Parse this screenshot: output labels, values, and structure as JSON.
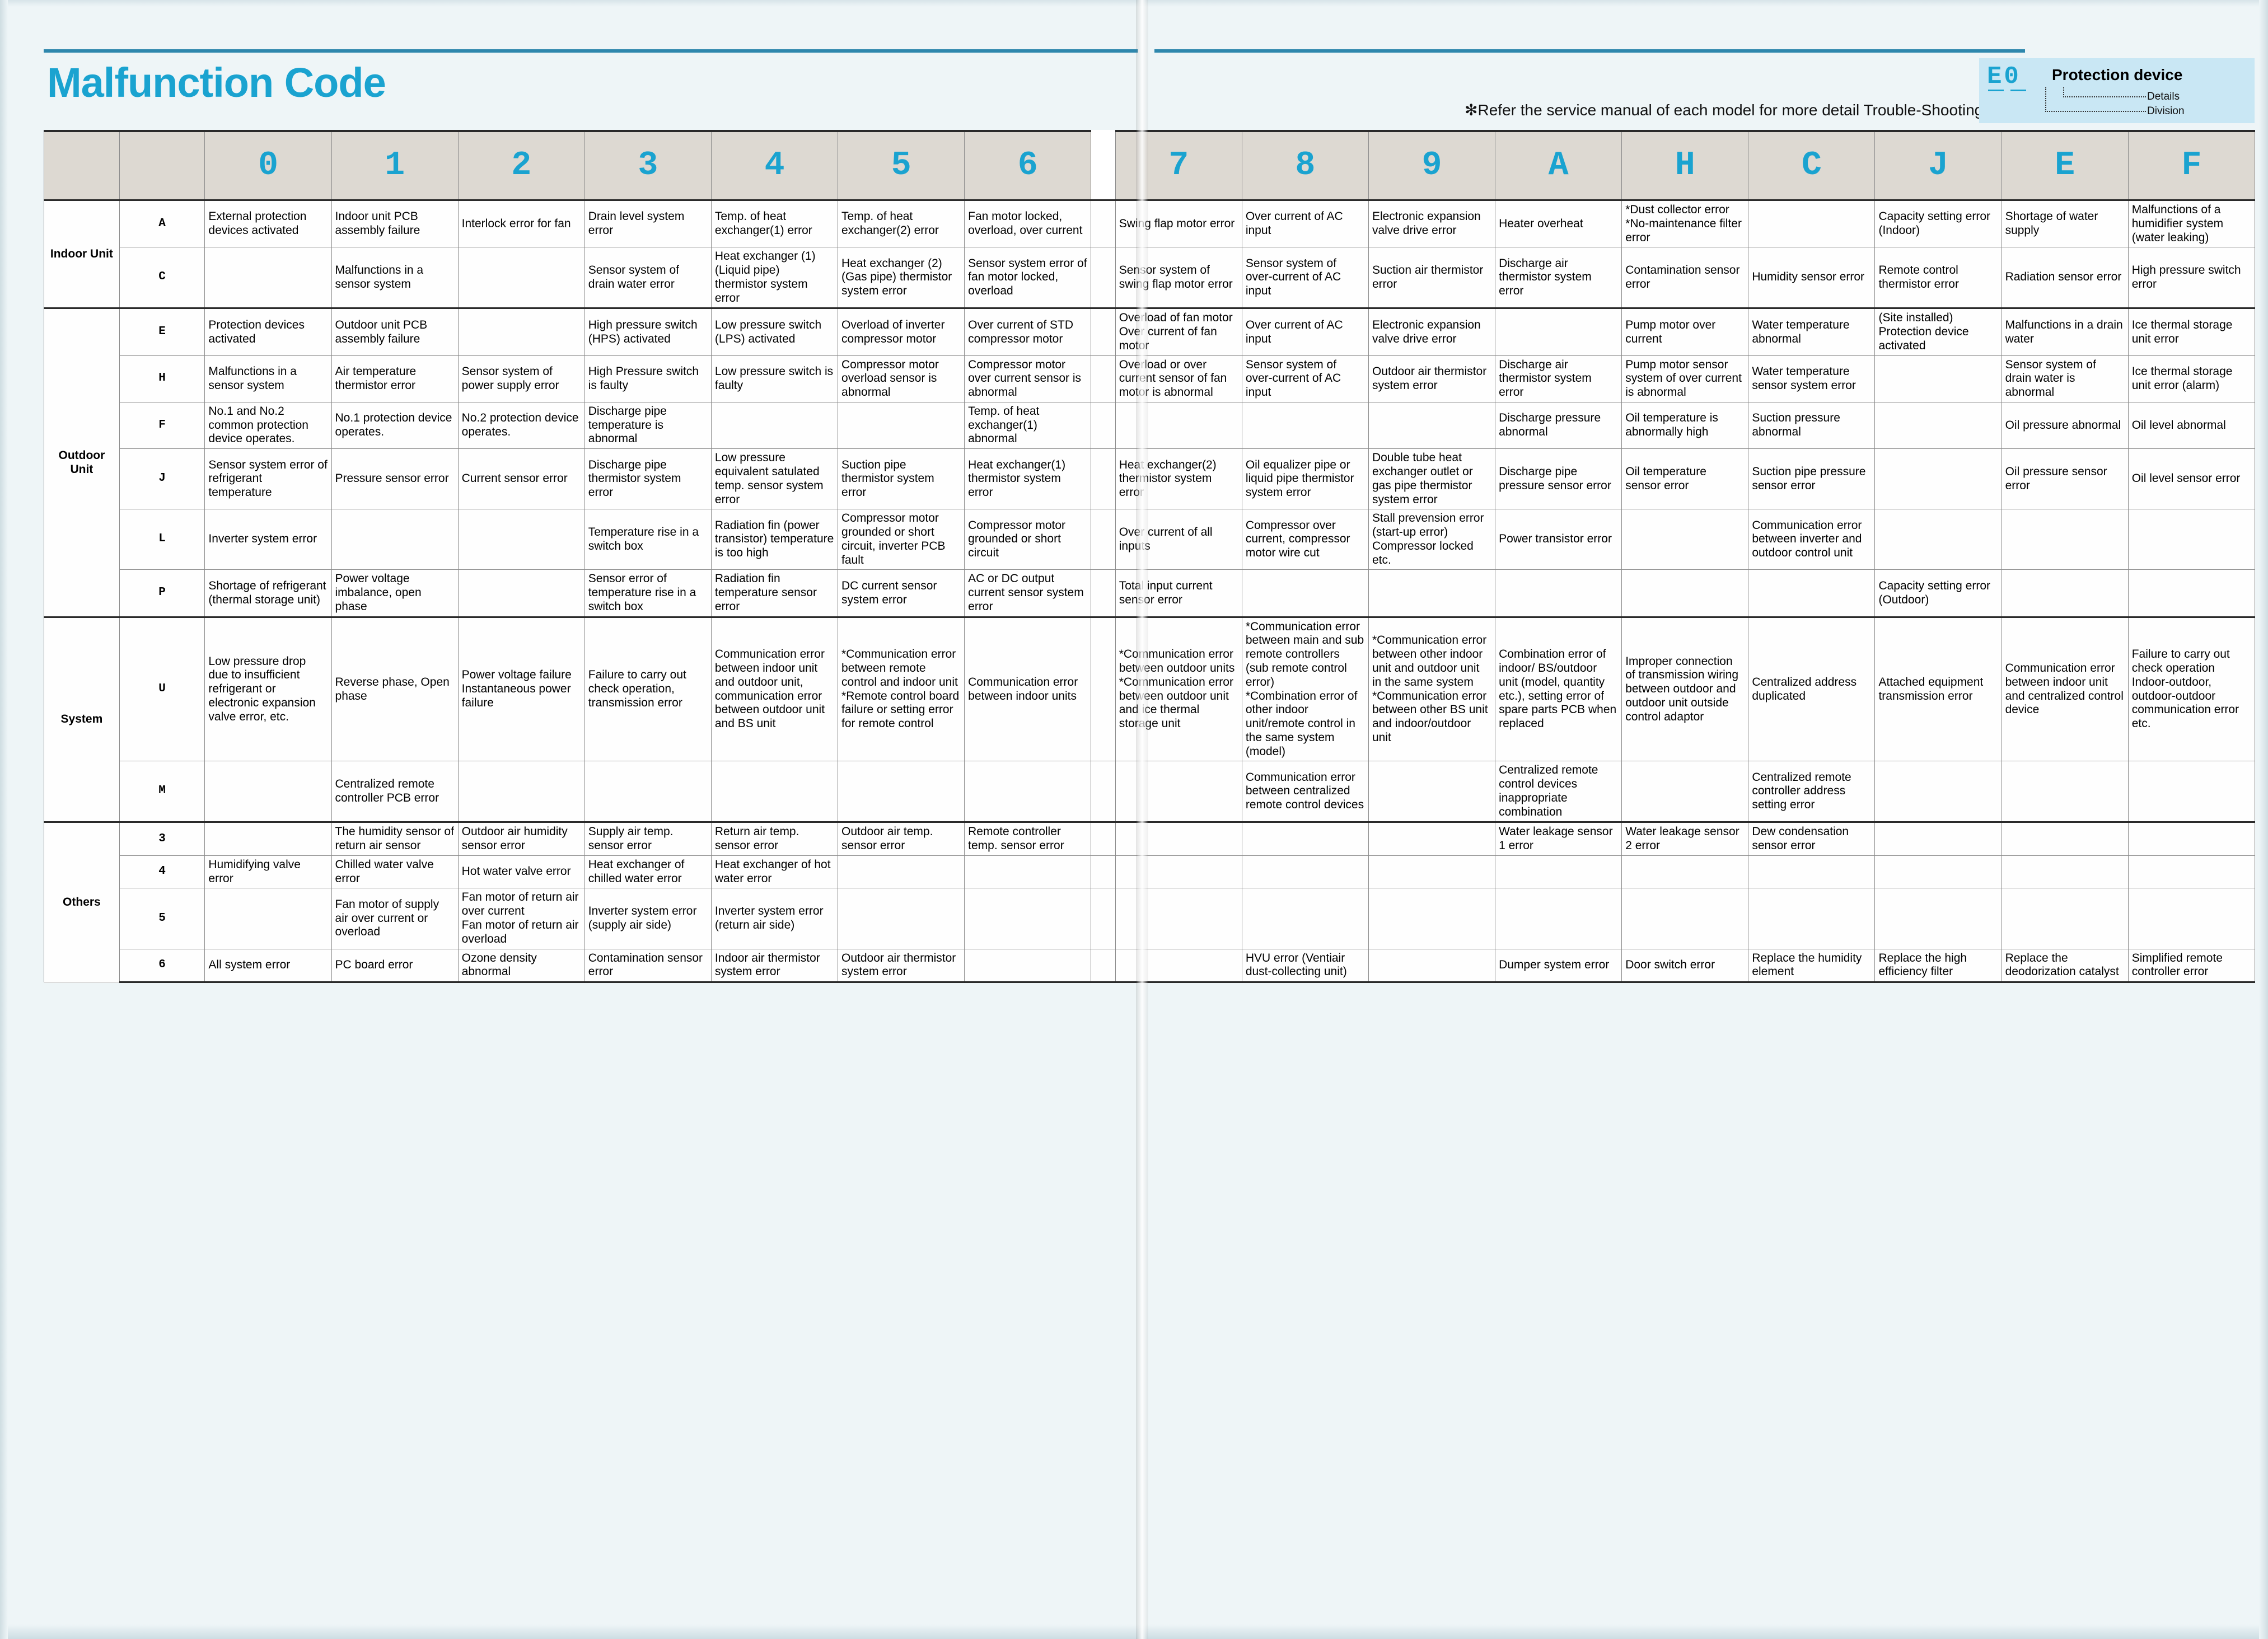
{
  "title": "Malfunction Code",
  "note": "✻Refer the service manual of each model for more detail Trouble-Shooting.",
  "legend": {
    "code": "E0",
    "title": "Protection device",
    "details_label": "Details",
    "division_label": "Division"
  },
  "colors": {
    "accent": "#1aa3d0",
    "rule": "#2e87ad",
    "section_bg": "#aee0f2",
    "code_bg": "#ddd9d2",
    "legend_bg": "#c9e7f4"
  },
  "columns": [
    "0",
    "1",
    "2",
    "3",
    "4",
    "5",
    "6",
    "7",
    "8",
    "9",
    "A",
    "H",
    "C",
    "J",
    "E",
    "F"
  ],
  "sections": [
    {
      "label": "Indoor Unit",
      "rows": [
        {
          "code": "A",
          "cells": [
            "External protection devices activated",
            "Indoor unit PCB assembly failure",
            "Interlock error for fan",
            "Drain level system error",
            "Temp. of heat exchanger(1) error",
            "Temp. of heat exchanger(2) error",
            "Fan motor locked, overload, over current",
            "Swing flap motor error",
            "Over current of AC input",
            "Electronic expansion valve drive error",
            "Heater overheat",
            "*Dust collector error\n*No-maintenance filter error",
            "",
            "Capacity setting error (Indoor)",
            "Shortage of water supply",
            "Malfunctions of a humidifier system (water leaking)"
          ]
        },
        {
          "code": "C",
          "cells": [
            "",
            "Malfunctions in a sensor system",
            "",
            "Sensor system of drain water error",
            "Heat exchanger (1) (Liquid pipe) thermistor system error",
            "Heat exchanger (2) (Gas pipe) thermistor system error",
            "Sensor system error of fan motor locked, overload",
            "Sensor system of swing flap motor error",
            "Sensor system of over-current of AC input",
            "Suction air thermistor error",
            "Discharge air thermistor system error",
            "Contamination sensor error",
            "Humidity sensor error",
            "Remote control thermistor error",
            "Radiation sensor error",
            "High pressure switch error"
          ]
        }
      ]
    },
    {
      "label": "Outdoor Unit",
      "rows": [
        {
          "code": "E",
          "cells": [
            "Protection devices activated",
            "Outdoor unit PCB assembly failure",
            "",
            "High pressure switch (HPS) activated",
            "Low pressure switch (LPS) activated",
            "Overload of inverter compressor motor",
            "Over current of STD compressor motor",
            "Overload of fan motor\nOver current of fan motor",
            "Over current of AC input",
            "Electronic expansion valve drive error",
            "",
            "Pump motor over current",
            "Water temperature abnormal",
            "(Site installed) Protection device activated",
            "Malfunctions in a drain water",
            "Ice thermal storage unit error"
          ]
        },
        {
          "code": "H",
          "cells": [
            "Malfunctions in a sensor system",
            "Air temperature thermistor error",
            "Sensor system of power supply error",
            "High Pressure switch is faulty",
            "Low pressure switch is faulty",
            "Compressor motor overload sensor is abnormal",
            "Compressor motor over current sensor is abnormal",
            "Overload or over current sensor of fan motor is abnormal",
            "Sensor system of over-current of AC input",
            "Outdoor air thermistor system error",
            "Discharge air thermistor system error",
            "Pump motor sensor system of over current is abnormal",
            "Water temperature sensor system error",
            "",
            "Sensor system of drain water is abnormal",
            "Ice thermal storage unit error (alarm)"
          ]
        },
        {
          "code": "F",
          "cells": [
            "No.1 and No.2 common protection device operates.",
            "No.1 protection device operates.",
            "No.2 protection device operates.",
            "Discharge pipe temperature is abnormal",
            "",
            "",
            "Temp. of heat exchanger(1) abnormal",
            "",
            "",
            "",
            "Discharge pressure abnormal",
            "Oil temperature is abnormally high",
            "Suction pressure abnormal",
            "",
            "Oil pressure abnormal",
            "Oil level abnormal"
          ]
        },
        {
          "code": "J",
          "cells": [
            "Sensor system error of refrigerant temperature",
            "Pressure sensor error",
            "Current sensor error",
            "Discharge pipe thermistor system error",
            "Low pressure equivalent satulated temp. sensor system error",
            "Suction pipe thermistor system error",
            "Heat exchanger(1) thermistor system error",
            "Heat exchanger(2) thermistor system error",
            "Oil equalizer pipe or liquid pipe thermistor system error",
            "Double tube heat exchanger outlet or gas pipe thermistor system error",
            "Discharge pipe pressure sensor error",
            "Oil temperature sensor error",
            "Suction pipe pressure sensor error",
            "",
            "Oil pressure sensor error",
            "Oil level sensor error"
          ]
        },
        {
          "code": "L",
          "cells": [
            "Inverter system error",
            "",
            "",
            "Temperature rise in a switch box",
            "Radiation fin (power transistor) temperature is too high",
            "Compressor motor grounded or short circuit, inverter PCB fault",
            "Compressor motor grounded or short circuit",
            "Over current of all inputs",
            "Compressor over current, compressor motor wire cut",
            "Stall prevension error (start-up error) Compressor locked etc.",
            "Power transistor error",
            "",
            "Communication error between inverter and outdoor control unit",
            "",
            "",
            ""
          ]
        },
        {
          "code": "P",
          "cells": [
            "Shortage of refrigerant (thermal storage unit)",
            "Power voltage imbalance, open phase",
            "",
            "Sensor error of temperature rise in a switch box",
            "Radiation fin temperature sensor error",
            "DC current sensor system error",
            "AC or DC output current sensor system error",
            "Total input current sensor error",
            "",
            "",
            "",
            "",
            "",
            "Capacity setting error (Outdoor)",
            "",
            ""
          ]
        }
      ]
    },
    {
      "label": "System",
      "rows": [
        {
          "code": "U",
          "cells": [
            "Low pressure drop due to insufficient refrigerant or electronic expansion valve error, etc.",
            "Reverse phase, Open phase",
            "Power voltage failure Instantaneous power failure",
            "Failure to carry out check operation, transmission error",
            "Communication error between indoor unit and outdoor unit, communication error between outdoor unit and BS unit",
            "*Communication error between remote control and indoor unit\n*Remote control board failure or setting error for remote control",
            "Communication error between indoor units",
            "*Communication error between outdoor units\n*Communication error between outdoor unit and ice thermal storage unit",
            "*Communication error between main and sub remote controllers (sub remote control error)\n*Combination error of other indoor unit/remote control in the same system (model)",
            "*Communication error between other indoor unit and outdoor unit in the same system\n*Communication error between other BS unit and indoor/outdoor unit",
            "Combination error of indoor/ BS/outdoor unit (model, quantity etc.), setting error of spare parts PCB when replaced",
            "Improper connection of transmission wiring between outdoor and outdoor unit outside control adaptor",
            "Centralized address duplicated",
            "Attached equipment transmission error",
            "Communication error between indoor unit and centralized control device",
            "Failure to carry out check operation Indoor-outdoor, outdoor-outdoor communication error etc."
          ]
        },
        {
          "code": "M",
          "cells": [
            "",
            "Centralized remote controller PCB error",
            "",
            "",
            "",
            "",
            "",
            "",
            "Communication error between centralized remote control devices",
            "",
            "Centralized remote control devices inappropriate combination",
            "",
            "Centralized remote controller address setting error",
            "",
            "",
            ""
          ]
        }
      ]
    },
    {
      "label": "Others",
      "rows": [
        {
          "code": "3",
          "cells": [
            "",
            "The humidity sensor of return air sensor",
            "Outdoor air humidity sensor error",
            "Supply air temp. sensor error",
            "Return air temp. sensor error",
            "Outdoor air temp. sensor error",
            "Remote controller temp. sensor error",
            "",
            "",
            "",
            "Water leakage sensor 1 error",
            "Water leakage sensor 2 error",
            "Dew condensation sensor error",
            "",
            "",
            ""
          ]
        },
        {
          "code": "4",
          "cells": [
            "Humidifying valve error",
            "Chilled water valve error",
            "Hot water valve error",
            "Heat exchanger of chilled water error",
            "Heat exchanger of hot water error",
            "",
            "",
            "",
            "",
            "",
            "",
            "",
            "",
            "",
            "",
            ""
          ]
        },
        {
          "code": "5",
          "cells": [
            "",
            "Fan motor of supply air over current or overload",
            "Fan motor of return air over current\nFan motor of return air overload",
            "Inverter system error (supply air side)",
            "Inverter system error (return air side)",
            "",
            "",
            "",
            "",
            "",
            "",
            "",
            "",
            "",
            "",
            ""
          ]
        },
        {
          "code": "6",
          "cells": [
            "All system error",
            "PC board error",
            "Ozone density abnormal",
            "Contamination sensor error",
            "Indoor air thermistor system error",
            "Outdoor air thermistor system error",
            "",
            "",
            "HVU error (Ventiair dust-collecting unit)",
            "",
            "Dumper system error",
            "Door switch error",
            "Replace the humidity element",
            "Replace the high efficiency filter",
            "Replace the deodorization catalyst",
            "Simplified remote controller error"
          ]
        }
      ]
    }
  ]
}
